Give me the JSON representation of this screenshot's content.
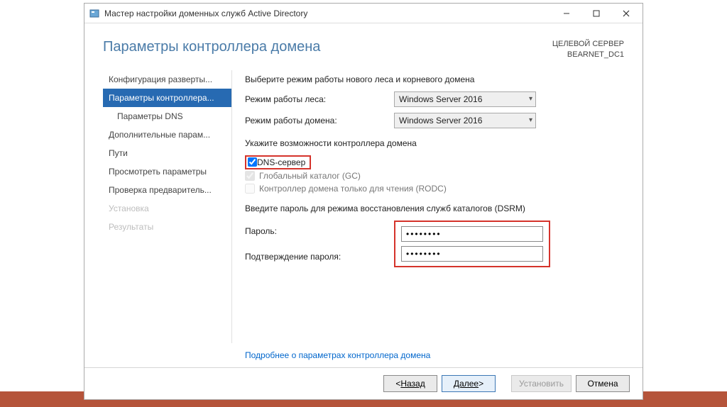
{
  "window": {
    "title": "Мастер настройки доменных служб Active Directory"
  },
  "header": {
    "page_title": "Параметры контроллера домена",
    "target_label": "ЦЕЛЕВОЙ СЕРВЕР",
    "target_name": "BEARNET_DC1"
  },
  "sidebar": {
    "items": [
      {
        "label": "Конфигурация разверты...",
        "indent": false,
        "selected": false,
        "disabled": false
      },
      {
        "label": "Параметры контроллера...",
        "indent": false,
        "selected": true,
        "disabled": false
      },
      {
        "label": "Параметры DNS",
        "indent": true,
        "selected": false,
        "disabled": false
      },
      {
        "label": "Дополнительные парам...",
        "indent": false,
        "selected": false,
        "disabled": false
      },
      {
        "label": "Пути",
        "indent": false,
        "selected": false,
        "disabled": false
      },
      {
        "label": "Просмотреть параметры",
        "indent": false,
        "selected": false,
        "disabled": false
      },
      {
        "label": "Проверка предваритель...",
        "indent": false,
        "selected": false,
        "disabled": false
      },
      {
        "label": "Установка",
        "indent": false,
        "selected": false,
        "disabled": true
      },
      {
        "label": "Результаты",
        "indent": false,
        "selected": false,
        "disabled": true
      }
    ]
  },
  "content": {
    "select_level_text": "Выберите режим работы нового леса и корневого домена",
    "forest_level_label": "Режим работы леса:",
    "forest_level_value": "Windows Server 2016",
    "domain_level_label": "Режим работы домена:",
    "domain_level_value": "Windows Server 2016",
    "capabilities_text": "Укажите возможности контроллера домена",
    "cb_dns": "DNS-сервер",
    "cb_gc": "Глобальный каталог (GC)",
    "cb_rodc": "Контроллер домена только для чтения (RODC)",
    "dsrm_text": "Введите пароль для режима восстановления служб каталогов (DSRM)",
    "password_label": "Пароль:",
    "confirm_label": "Подтверждение пароля:",
    "password_value": "••••••••",
    "confirm_value": "••••••••",
    "more_link": "Подробнее о параметрах контроллера домена"
  },
  "footer": {
    "back": "Назад",
    "next": "Далее",
    "install": "Установить",
    "cancel": "Отмена"
  }
}
